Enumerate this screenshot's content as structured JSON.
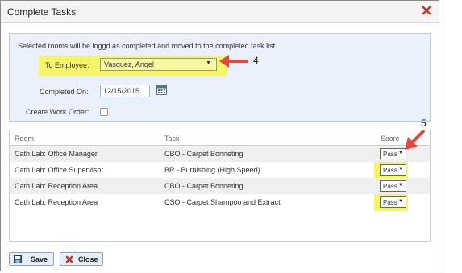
{
  "dialog": {
    "title": "Complete Tasks",
    "message": "Selected rooms will be loggd as completed and moved to the completed task list",
    "to_employee_label": "To Employee:",
    "to_employee_value": "Vasquez, Angel",
    "completed_on_label": "Completed On:",
    "completed_on_value": "12/15/2015",
    "create_work_order_label": "Create Work Order:",
    "create_work_order_checked": false
  },
  "grid": {
    "columns": [
      "Room",
      "Task",
      "Score"
    ],
    "rows": [
      {
        "room": "Cath Lab: Office Manager",
        "task": "CBO - Carpet Bonneting",
        "score": "Pass"
      },
      {
        "room": "Cath Lab: Office Supervisor",
        "task": "BR - Burnishing (High Speed)",
        "score": "Pass"
      },
      {
        "room": "Cath Lab: Reception Area",
        "task": "CBO - Carpet Bonneting",
        "score": "Pass"
      },
      {
        "room": "Cath Lab: Reception Area",
        "task": "CSO - Carpet Shampoo and Extract",
        "score": "Pass"
      }
    ]
  },
  "buttons": {
    "save": "Save",
    "close": "Close"
  },
  "annotations": {
    "employee_marker": "4",
    "score_marker": "5"
  },
  "colors": {
    "highlight": "#f5f56a",
    "arrow": "#e8453c",
    "close_icon": "#c0392b"
  }
}
